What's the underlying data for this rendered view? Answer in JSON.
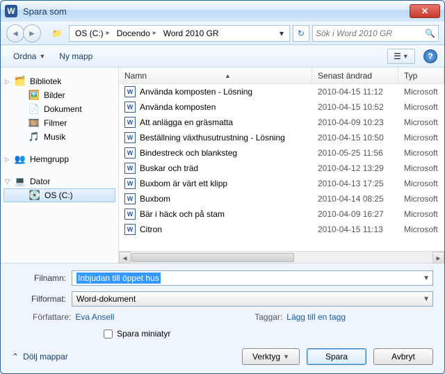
{
  "window": {
    "title": "Spara som"
  },
  "nav": {
    "breadcrumb": [
      "OS (C:)",
      "Docendo",
      "Word 2010 GR"
    ],
    "search_placeholder": "Sök i Word 2010 GR"
  },
  "toolbar": {
    "organize": "Ordna",
    "new_folder": "Ny mapp"
  },
  "sidebar": {
    "libraries": {
      "label": "Bibliotek",
      "items": [
        "Bilder",
        "Dokument",
        "Filmer",
        "Musik"
      ]
    },
    "homegroup": "Hemgrupp",
    "computer": {
      "label": "Dator",
      "drive": "OS (C:)"
    }
  },
  "columns": {
    "name": "Namn",
    "modified": "Senast ändrad",
    "type": "Typ"
  },
  "files": [
    {
      "name": "Använda komposten - Lösning",
      "date": "2010-04-15 11:12",
      "type": "Microsoft"
    },
    {
      "name": "Använda komposten",
      "date": "2010-04-15 10:52",
      "type": "Microsoft"
    },
    {
      "name": "Att anlägga en gräsmatta",
      "date": "2010-04-09 10:23",
      "type": "Microsoft"
    },
    {
      "name": "Beställning växthusutrustning - Lösning",
      "date": "2010-04-15 10:50",
      "type": "Microsoft"
    },
    {
      "name": "Bindestreck och blanksteg",
      "date": "2010-05-25 11:56",
      "type": "Microsoft"
    },
    {
      "name": "Buskar och träd",
      "date": "2010-04-12 13:29",
      "type": "Microsoft"
    },
    {
      "name": "Buxbom är värt ett klipp",
      "date": "2010-04-13 17:25",
      "type": "Microsoft"
    },
    {
      "name": "Buxbom",
      "date": "2010-04-14 08:25",
      "type": "Microsoft"
    },
    {
      "name": "Bär i häck och på stam",
      "date": "2010-04-09 16:27",
      "type": "Microsoft"
    },
    {
      "name": "Citron",
      "date": "2010-04-15 11:13",
      "type": "Microsoft"
    }
  ],
  "form": {
    "filename_label": "Filnamn:",
    "filename_value": "Inbjudan till öppet hus",
    "filetype_label": "Filformat:",
    "filetype_value": "Word-dokument",
    "author_label": "Författare:",
    "author_value": "Eva Ansell",
    "tags_label": "Taggar:",
    "tags_value": "Lägg till en tagg",
    "save_thumb": "Spara miniatyr"
  },
  "actions": {
    "hide_folders": "Dölj mappar",
    "tools": "Verktyg",
    "save": "Spara",
    "cancel": "Avbryt"
  }
}
